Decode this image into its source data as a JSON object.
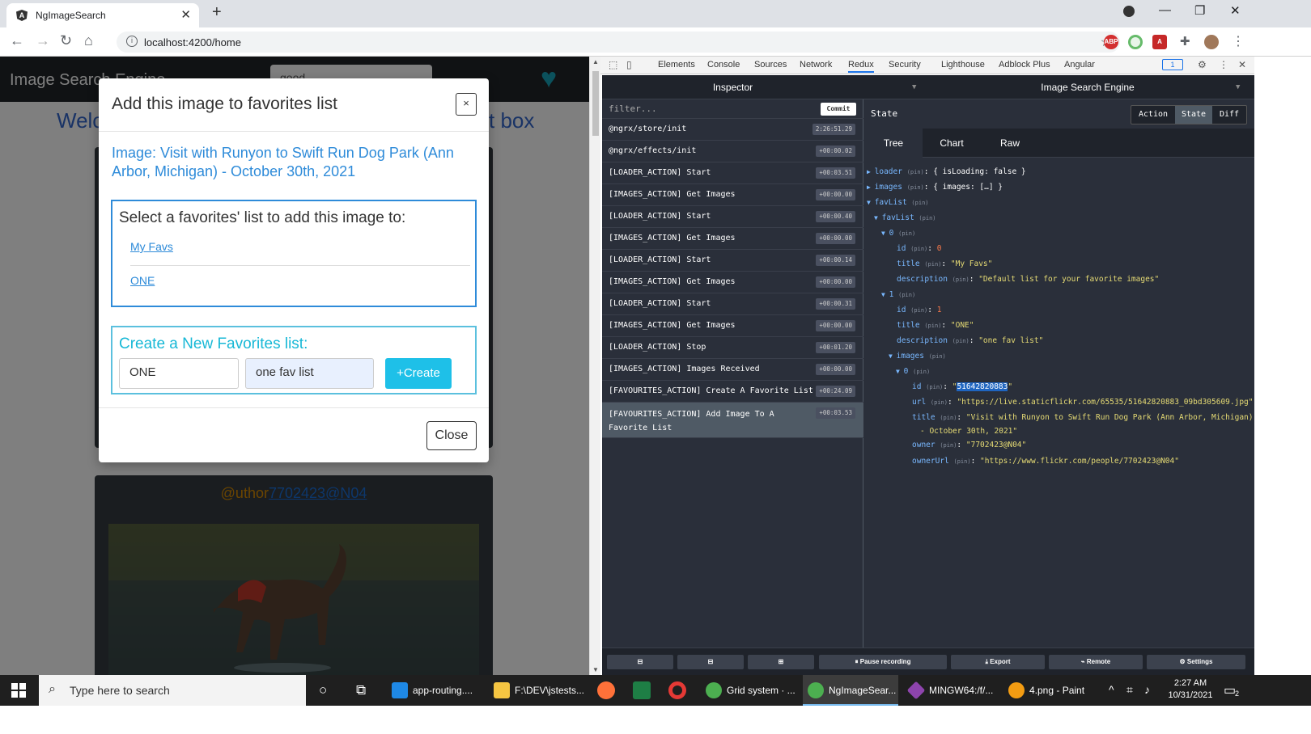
{
  "browser": {
    "tab_title": "NgImageSearch",
    "url": "localhost:4200/home",
    "extensions": [
      "ABP",
      "A"
    ]
  },
  "app": {
    "brand": "Image Search Engine",
    "search_value": "good",
    "welcome_left": "Welc",
    "welcome_right": "t box",
    "author_prefix": "@uthor",
    "author_link": "7702423@N04"
  },
  "modal": {
    "title": "Add this image to favorites list",
    "close_x": "×",
    "image_title": "Image: Visit with Runyon to Swift Run Dog Park (Ann Arbor, Michigan) - October 30th, 2021",
    "select_label": "Select a favorites' list to add this image to:",
    "lists": [
      "My Favs",
      "ONE"
    ],
    "create_label": "Create a New Favorites list:",
    "name_value": "ONE",
    "description_value": "one fav list",
    "create_button": "+Create",
    "close_button": "Close"
  },
  "devtools": {
    "tabs": [
      "Elements",
      "Console",
      "Sources",
      "Network",
      "Redux",
      "Security",
      "Lighthouse",
      "Adblock Plus",
      "Angular"
    ],
    "active_tab": "Redux",
    "badge": "1"
  },
  "redux": {
    "inspector": "Inspector",
    "instance": "Image Search Engine",
    "filter_placeholder": "filter...",
    "commit": "Commit",
    "actions": [
      {
        "name": "@ngrx/store/init",
        "time": "2:26:51.29"
      },
      {
        "name": "@ngrx/effects/init",
        "time": "+00:00.02"
      },
      {
        "name": "[LOADER_ACTION] Start",
        "time": "+00:03.51"
      },
      {
        "name": "[IMAGES_ACTION] Get Images",
        "time": "+00:00.00"
      },
      {
        "name": "[LOADER_ACTION] Start",
        "time": "+00:00.40"
      },
      {
        "name": "[IMAGES_ACTION] Get Images",
        "time": "+00:00.00"
      },
      {
        "name": "[LOADER_ACTION] Start",
        "time": "+00:00.14"
      },
      {
        "name": "[IMAGES_ACTION] Get Images",
        "time": "+00:00.00"
      },
      {
        "name": "[LOADER_ACTION] Start",
        "time": "+00:00.31"
      },
      {
        "name": "[IMAGES_ACTION] Get Images",
        "time": "+00:00.00"
      },
      {
        "name": "[LOADER_ACTION] Stop",
        "time": "+00:01.20"
      },
      {
        "name": "[IMAGES_ACTION] Images Received",
        "time": "+00:00.00"
      },
      {
        "name": "[FAVOURITES_ACTION] Create A Favorite List",
        "time": "+00:24.09"
      },
      {
        "name": "[FAVOURITES_ACTION] Add Image To A Favorite List",
        "time": "+00:03.53"
      }
    ],
    "state_label": "State",
    "modes": [
      "Action",
      "State",
      "Diff"
    ],
    "active_mode": "State",
    "subtabs": [
      "Tree",
      "Chart",
      "Raw"
    ],
    "active_subtab": "Tree",
    "pin": "(pin)",
    "tree": {
      "loader_key": "loader",
      "loader_val": "{ isLoading: false }",
      "images_key": "images",
      "images_val": "{ images: […] }",
      "favList_key": "favList",
      "favList_inner": "favList",
      "idx0": "0",
      "idx1": "1",
      "id_key": "id",
      "title_key": "title",
      "desc_key": "description",
      "images_inner": "images",
      "url_key": "url",
      "owner_key": "owner",
      "ownerUrl_key": "ownerUrl",
      "item0_id": "0",
      "item0_title": "\"My Favs\"",
      "item0_desc": "\"Default list for your favorite images\"",
      "item1_id": "1",
      "item1_title": "\"ONE\"",
      "item1_desc": "\"one fav list\"",
      "img_id": "51642820883",
      "img_url": "\"https://live.staticflickr.com/65535/51642820883_09bd305609.jpg\"",
      "img_title_1": "\"Visit with Runyon to Swift Run Dog Park (Ann Arbor, Michigan)",
      "img_title_2": "- October 30th, 2021\"",
      "img_owner": "\"7702423@N04\"",
      "img_ownerUrl": "\"https://www.flickr.com/people/7702423@N04\""
    },
    "footer": {
      "pause": "Pause recording",
      "export": "Export",
      "remote": "Remote",
      "settings": "Settings"
    }
  },
  "taskbar": {
    "search_placeholder": "Type here to search",
    "apps": [
      "app-routing....",
      "F:\\DEV\\jstests...",
      "Grid system · ...",
      "NgImageSear...",
      "MINGW64:/f/...",
      "4.png - Paint"
    ],
    "time": "2:27 AM",
    "date": "10/31/2021",
    "notifications": "2"
  }
}
